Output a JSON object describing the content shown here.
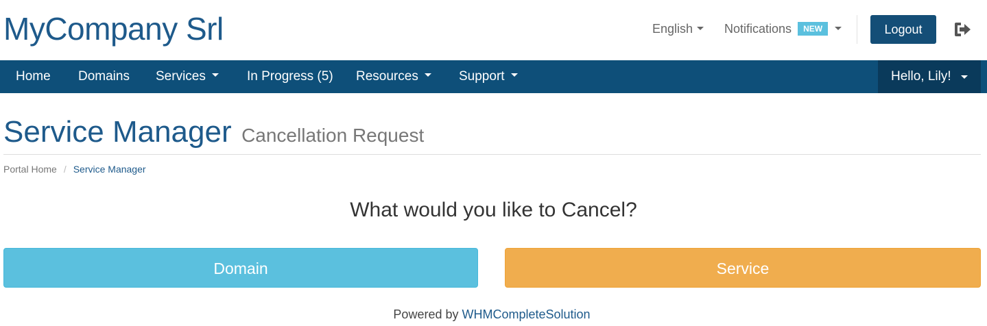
{
  "header": {
    "logo_text": "MyCompany Srl",
    "language_label": "English",
    "notifications_label": "Notifications",
    "notifications_badge": "NEW",
    "logout_label": "Logout"
  },
  "navbar": {
    "items": [
      {
        "label": "Home",
        "dropdown": false
      },
      {
        "label": "Domains",
        "dropdown": false
      },
      {
        "label": "Services",
        "dropdown": true
      },
      {
        "label": "In Progress (5)",
        "dropdown": false
      },
      {
        "label": "Resources",
        "dropdown": true
      },
      {
        "label": "Support",
        "dropdown": true
      }
    ],
    "user_greeting": "Hello, Lily!"
  },
  "page": {
    "title": "Service Manager",
    "subtitle": "Cancellation Request",
    "breadcrumb": [
      "Portal Home",
      "Service Manager"
    ],
    "question": "What would you like to Cancel?",
    "buttons": {
      "domain": "Domain",
      "service": "Service"
    }
  },
  "footer": {
    "prefix": "Powered by",
    "link_text": "WHMCompleteSolution"
  },
  "colors": {
    "brand_blue": "#1e5a8b",
    "navbar": "#0e4f79",
    "navbar_user": "#0a3a5b",
    "domain_button": "#5bc0de",
    "service_button": "#f0ad4e",
    "badge": "#5bc0de"
  },
  "icons": {
    "logout": "sign-out-icon",
    "dropdown": "caret-down-icon"
  }
}
